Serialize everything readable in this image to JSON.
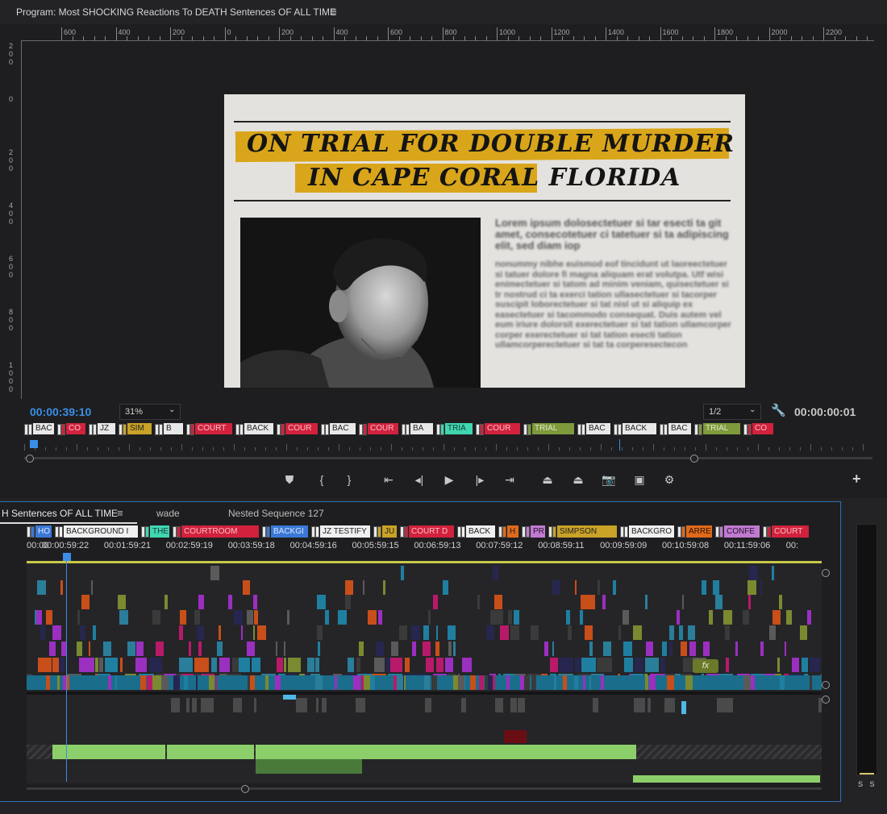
{
  "program": {
    "title": "Program: Most SHOCKING Reactions To DEATH Sentences OF ALL TIME",
    "ruler_labels": [
      "600",
      "400",
      "200",
      "0",
      "200",
      "400",
      "600",
      "800",
      "1000",
      "1200",
      "1400",
      "1600",
      "1800",
      "2000",
      "2200"
    ],
    "vruler_labels": [
      "200",
      "0",
      "200",
      "400",
      "600",
      "800",
      "1000"
    ],
    "headline_line1": "ON TRIAL FOR DOUBLE MURDER",
    "headline_line2": "IN CAPE CORAL FLORIDA",
    "body_text_1": "Lorem ipsum dolosectetuer si tar esecti ta git amet, consecotetuer ci tatetuer si ta adipiscing elit, sed diam iop",
    "body_text_2": "nonummy nibhe euismod eof tincidunt ut laoreectetuer si tatuer dolore fi magna aliquam erat volutpa. Utf wisi enimectetuer si tatom ad minim veniam, quisectetuer si tr nostrud ci ta exerci tation ullasectetuer si tacorper suscipit loborectetuer si tat nisl ut si aliquip ex easectetuer si tacommodo consequat. Duis autem vel eum iriure dolorsit exerectetuer si tat tation ullamcorper corper exerectetuer si tat tation esecti tation ullamcorperectetuer si tat ta corperesectecon",
    "timecode_current": "00:00:39:10",
    "zoom": "31%",
    "resolution": "1/2",
    "timecode_duration": "00:00:00:01"
  },
  "program_markers": [
    {
      "label": "BAC",
      "color": "#e8e8e8",
      "text": "#222"
    },
    {
      "label": "CO",
      "color": "#d1213c",
      "text": "#f3c0c8"
    },
    {
      "label": "JZ",
      "color": "#e8e8e8",
      "text": "#222"
    },
    {
      "label": "SIM",
      "color": "#c9a227",
      "text": "#222"
    },
    {
      "label": "B",
      "color": "#e8e8e8",
      "text": "#222"
    },
    {
      "label": "COURT",
      "color": "#d1213c",
      "text": "#f3c0c8"
    },
    {
      "label": "BACK",
      "color": "#e8e8e8",
      "text": "#222"
    },
    {
      "label": "COUR",
      "color": "#d1213c",
      "text": "#f3c0c8"
    },
    {
      "label": "BAC",
      "color": "#e8e8e8",
      "text": "#222"
    },
    {
      "label": "COUR",
      "color": "#d1213c",
      "text": "#f3c0c8"
    },
    {
      "label": "BA",
      "color": "#e8e8e8",
      "text": "#222"
    },
    {
      "label": "TRIA",
      "color": "#3fd6b0",
      "text": "#1a3a33"
    },
    {
      "label": "COUR",
      "color": "#d1213c",
      "text": "#f3c0c8"
    },
    {
      "label": "TRIAL",
      "color": "#7e9a3c",
      "text": "#dfe8c8"
    },
    {
      "label": "BAC",
      "color": "#e8e8e8",
      "text": "#222"
    },
    {
      "label": "BACK",
      "color": "#e8e8e8",
      "text": "#222"
    },
    {
      "label": "BAC",
      "color": "#e8e8e8",
      "text": "#222"
    },
    {
      "label": "TRIAL",
      "color": "#7e9a3c",
      "text": "#dfe8c8"
    },
    {
      "label": "CO",
      "color": "#d1213c",
      "text": "#f3c0c8"
    }
  ],
  "timeline": {
    "tabs": [
      {
        "label": "H Sentences OF ALL TIME",
        "active": true
      },
      {
        "label": "wade",
        "active": false
      },
      {
        "label": "Nested Sequence 127",
        "active": false
      }
    ],
    "markers": [
      {
        "label": "HO",
        "color": "#3a78d6",
        "text": "#dce8fb"
      },
      {
        "label": "BACKGROUND I",
        "color": "#f0f0f0",
        "text": "#222"
      },
      {
        "label": "THE",
        "color": "#3fd6b0",
        "text": "#1a3a33"
      },
      {
        "label": "COURTROOM",
        "color": "#d1213c",
        "text": "#f3c0c8"
      },
      {
        "label": "BACKGI",
        "color": "#3a78d6",
        "text": "#dce8fb"
      },
      {
        "label": "JZ TESTIFY",
        "color": "#f0f0f0",
        "text": "#222"
      },
      {
        "label": "JU",
        "color": "#c9a227",
        "text": "#222"
      },
      {
        "label": "COURT D",
        "color": "#d1213c",
        "text": "#f3c0c8"
      },
      {
        "label": "BACK",
        "color": "#f0f0f0",
        "text": "#222"
      },
      {
        "label": "H",
        "color": "#e06a1a",
        "text": "#222"
      },
      {
        "label": "PR",
        "color": "#c07ad0",
        "text": "#2a1030"
      },
      {
        "label": "SIMPSON",
        "color": "#c9a227",
        "text": "#222"
      },
      {
        "label": "BACKGRO",
        "color": "#f0f0f0",
        "text": "#222"
      },
      {
        "label": "ARRE",
        "color": "#e06a1a",
        "text": "#2a1205"
      },
      {
        "label": "CONFE",
        "color": "#c07ad0",
        "text": "#2a1030"
      },
      {
        "label": "COURT",
        "color": "#d1213c",
        "text": "#f3c0c8"
      }
    ],
    "timecodes": [
      "00:00",
      "00:00:59:22",
      "00:01:59:21",
      "00:02:59:19",
      "00:03:59:18",
      "00:04:59:16",
      "00:05:59:15",
      "00:06:59:13",
      "00:07:59:12",
      "00:08:59:11",
      "00:09:59:09",
      "00:10:59:08",
      "00:11:59:06",
      "00:"
    ],
    "fx_badge": "fx"
  },
  "meter_labels": "S S",
  "icons": {
    "panel_menu": "hamburger-icon",
    "wrench": "wrench-icon",
    "add": "plus-icon"
  }
}
